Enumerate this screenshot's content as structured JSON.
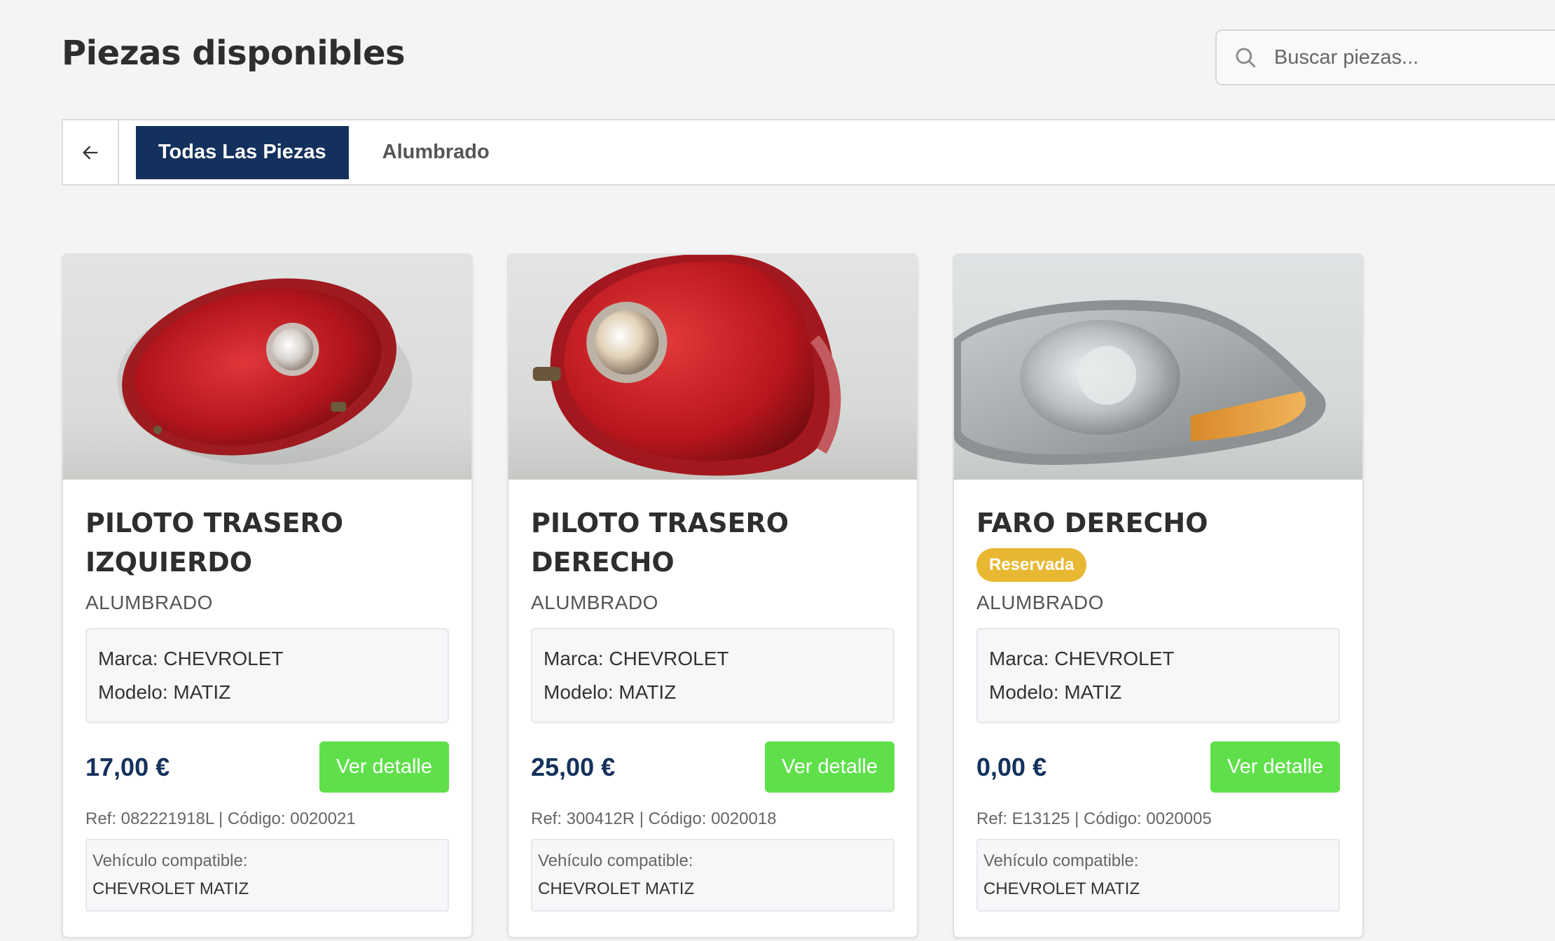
{
  "header": {
    "title": "Piezas disponibles",
    "search_placeholder": "Buscar piezas..."
  },
  "tabs": [
    {
      "label": "Todas Las Piezas",
      "active": true
    },
    {
      "label": "Alumbrado",
      "active": false
    }
  ],
  "products": [
    {
      "title": "PILOTO TRASERO IZQUIERDO",
      "badge": "",
      "category": "ALUMBRADO",
      "brand": "Marca: CHEVROLET",
      "model": "Modelo: MATIZ",
      "price": "17,00 €",
      "button": "Ver detalle",
      "ref": "Ref: 082221918L | Código: 0020021",
      "compat_label": "Vehículo compatible:",
      "compat_value": "CHEVROLET MATIZ"
    },
    {
      "title": "PILOTO TRASERO DERECHO",
      "badge": "",
      "category": "ALUMBRADO",
      "brand": "Marca: CHEVROLET",
      "model": "Modelo: MATIZ",
      "price": "25,00 €",
      "button": "Ver detalle",
      "ref": "Ref: 300412R | Código: 0020018",
      "compat_label": "Vehículo compatible:",
      "compat_value": "CHEVROLET MATIZ"
    },
    {
      "title": "FARO DERECHO",
      "badge": "Reservada",
      "category": "ALUMBRADO",
      "brand": "Marca: CHEVROLET",
      "model": "Modelo: MATIZ",
      "price": "0,00 €",
      "button": "Ver detalle",
      "ref": "Ref: E13125 | Código: 0020005",
      "compat_label": "Vehículo compatible:",
      "compat_value": "CHEVROLET MATIZ"
    }
  ],
  "colors": {
    "primary": "#13315c",
    "button_green": "#5fe04a",
    "badge_reserved": "#e8b832"
  },
  "icons": {
    "search": "search-icon",
    "back": "arrow-left-icon"
  }
}
